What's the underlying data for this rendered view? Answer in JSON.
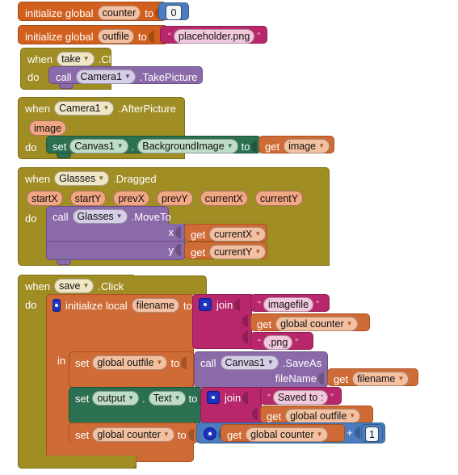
{
  "app": {
    "name": "MIT App Inventor Blocks Editor",
    "background": "#ffffff"
  },
  "palette": {
    "event_gold": "#a08d24",
    "variable_orange": "#d1601e",
    "text_magenta": "#b8276b",
    "setter_green": "#2b7050",
    "procedure_purple": "#8a6aa8",
    "math_blue": "#4a7cbf",
    "param_salmon": "#f1a783"
  },
  "blocks": {
    "init_counter": {
      "kind": "initialize-global",
      "label": "initialize global",
      "name": "counter",
      "to": "to",
      "value": "0",
      "value_type": "number"
    },
    "init_outfile": {
      "kind": "initialize-global",
      "label": "initialize global",
      "name": "outfile",
      "to": "to",
      "value": "placeholder.png",
      "value_type": "text"
    },
    "take_click": {
      "when": "when",
      "component": "take",
      "event": ".Click",
      "do": "do",
      "call": {
        "call": "call",
        "component": "Camera1",
        "method": ".TakePicture"
      }
    },
    "after_picture": {
      "when": "when",
      "component": "Camera1",
      "event": ".AfterPicture",
      "params": [
        "image"
      ],
      "do": "do",
      "set": {
        "set": "set",
        "component": "Canvas1",
        "dot": ".",
        "property": "BackgroundImage",
        "to": "to",
        "value": {
          "get": "get",
          "name": "image"
        }
      }
    },
    "glasses_dragged": {
      "when": "when",
      "component": "Glasses",
      "event": ".Dragged",
      "params": [
        "startX",
        "startY",
        "prevX",
        "prevY",
        "currentX",
        "currentY"
      ],
      "do": "do",
      "call": {
        "call": "call",
        "component": "Glasses",
        "method": ".MoveTo",
        "args": [
          {
            "name": "x",
            "value": {
              "get": "get",
              "name": "currentX"
            }
          },
          {
            "name": "y",
            "value": {
              "get": "get",
              "name": "currentY"
            }
          }
        ]
      }
    },
    "save_click": {
      "when": "when",
      "component": "save",
      "event": ".Click",
      "do": "do",
      "local": {
        "label": "initialize local",
        "name": "filename",
        "to": "to",
        "in": "in",
        "join_label": "join",
        "join_items": [
          {
            "type": "text",
            "value": "imagefile"
          },
          {
            "type": "get",
            "get": "get",
            "name": "global counter"
          },
          {
            "type": "text",
            "value": ".png"
          }
        ],
        "body": [
          {
            "kind": "set-global",
            "set": "set",
            "name": "global outfile",
            "to": "to",
            "value": {
              "call": "call",
              "component": "Canvas1",
              "method": ".SaveAs",
              "arg_label": "fileName",
              "arg_value": {
                "get": "get",
                "name": "filename"
              }
            }
          },
          {
            "kind": "set-property",
            "set": "set",
            "component": "output",
            "dot": ".",
            "property": "Text",
            "to": "to",
            "join_label": "join",
            "join_items": [
              {
                "type": "text",
                "value": "Saved to : "
              },
              {
                "type": "get",
                "get": "get",
                "name": "global outfile"
              }
            ]
          },
          {
            "kind": "set-global",
            "set": "set",
            "name": "global counter",
            "to": "to",
            "math": {
              "left": {
                "get": "get",
                "name": "global counter"
              },
              "operator": "+",
              "right": "1"
            }
          }
        ]
      }
    }
  }
}
